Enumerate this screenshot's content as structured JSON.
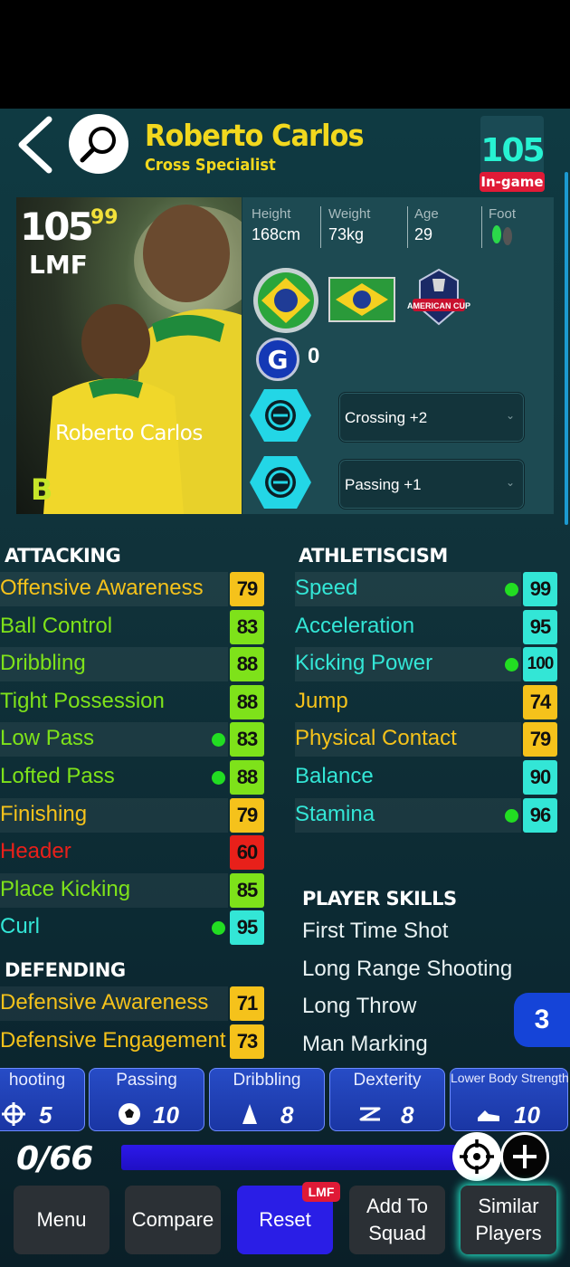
{
  "header": {
    "player_name": "Roberto Carlos",
    "playing_style": "Cross Specialist",
    "overall": "105",
    "overall_tag": "In-game"
  },
  "card": {
    "rating": "105",
    "max_rating": "99",
    "position": "LMF",
    "name": "Roberto Carlos",
    "grade": "B"
  },
  "bio": {
    "height_label": "Height",
    "height_value": "168cm",
    "weight_label": "Weight",
    "weight_value": "73kg",
    "age_label": "Age",
    "age_value": "29",
    "foot_label": "Foot"
  },
  "badges": {
    "cup_text": "AMERICAN CUP",
    "g_count": "0",
    "boost1": "Crossing +2",
    "boost2": "Passing +1"
  },
  "attacking": {
    "title": "ATTACKING",
    "stats": [
      {
        "name": "Offensive Awareness",
        "value": "79",
        "color": "#f5c21b",
        "dot": false,
        "name_color": "#f5c21b"
      },
      {
        "name": "Ball Control",
        "value": "83",
        "color": "#7ee21a",
        "dot": false,
        "name_color": "#7ee21a"
      },
      {
        "name": "Dribbling",
        "value": "88",
        "color": "#7ee21a",
        "dot": false,
        "name_color": "#7ee21a"
      },
      {
        "name": "Tight Possession",
        "value": "88",
        "color": "#7ee21a",
        "dot": false,
        "name_color": "#7ee21a"
      },
      {
        "name": "Low Pass",
        "value": "83",
        "color": "#7ee21a",
        "dot": true,
        "name_color": "#7ee21a"
      },
      {
        "name": "Lofted Pass",
        "value": "88",
        "color": "#7ee21a",
        "dot": true,
        "name_color": "#7ee21a"
      },
      {
        "name": "Finishing",
        "value": "79",
        "color": "#f5c21b",
        "dot": false,
        "name_color": "#f5c21b"
      },
      {
        "name": "Header",
        "value": "60",
        "color": "#e8201a",
        "dot": false,
        "name_color": "#e8201a"
      },
      {
        "name": "Place Kicking",
        "value": "85",
        "color": "#7ee21a",
        "dot": false,
        "name_color": "#7ee21a"
      },
      {
        "name": "Curl",
        "value": "95",
        "color": "#33e6d6",
        "dot": true,
        "name_color": "#33e6d6"
      }
    ]
  },
  "defending": {
    "title": "DEFENDING",
    "stats": [
      {
        "name": "Defensive Awareness",
        "value": "71",
        "color": "#f5c21b",
        "dot": false,
        "name_color": "#f5c21b"
      },
      {
        "name": "Defensive Engagement",
        "value": "73",
        "color": "#f5c21b",
        "dot": false,
        "name_color": "#f5c21b"
      }
    ]
  },
  "athleticism": {
    "title": "ATHLETISCISM",
    "stats": [
      {
        "name": "Speed",
        "value": "99",
        "color": "#33e6d6",
        "dot": true,
        "name_color": "#33e6d6"
      },
      {
        "name": "Acceleration",
        "value": "95",
        "color": "#33e6d6",
        "dot": false,
        "name_color": "#33e6d6"
      },
      {
        "name": "Kicking Power",
        "value": "100",
        "color": "#33e6d6",
        "dot": true,
        "name_color": "#33e6d6"
      },
      {
        "name": "Jump",
        "value": "74",
        "color": "#f5c21b",
        "dot": false,
        "name_color": "#f5c21b"
      },
      {
        "name": "Physical Contact",
        "value": "79",
        "color": "#f5c21b",
        "dot": false,
        "name_color": "#f5c21b"
      },
      {
        "name": "Balance",
        "value": "90",
        "color": "#33e6d6",
        "dot": false,
        "name_color": "#33e6d6"
      },
      {
        "name": "Stamina",
        "value": "96",
        "color": "#33e6d6",
        "dot": true,
        "name_color": "#33e6d6"
      }
    ]
  },
  "skills": {
    "title": "PLAYER SKILLS",
    "items": [
      "First Time Shot",
      "Long Range Shooting",
      "Long Throw",
      "Man Marking"
    ]
  },
  "page_badge": "3",
  "progression": {
    "categories": [
      {
        "label": "hooting",
        "value": "5",
        "icon": "crosshair-icon"
      },
      {
        "label": "Passing",
        "value": "10",
        "icon": "ball-icon"
      },
      {
        "label": "Dribbling",
        "value": "8",
        "icon": "cone-icon"
      },
      {
        "label": "Dexterity",
        "value": "8",
        "icon": "zigzag-icon"
      },
      {
        "label": "Lower Body Strength",
        "value": "10",
        "icon": "boot-icon"
      }
    ],
    "points": "0/66"
  },
  "nav": {
    "menu": "Menu",
    "compare": "Compare",
    "reset": "Reset",
    "reset_tag": "LMF",
    "add_to_squad": "Add To Squad",
    "similar_players": "Similar Players"
  }
}
